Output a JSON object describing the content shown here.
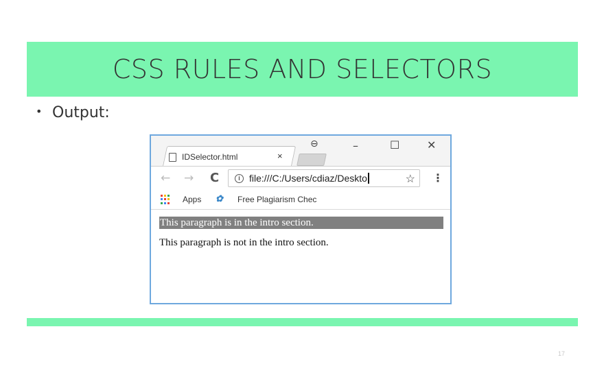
{
  "slide": {
    "title": "CSS RULES AND SELECTORS",
    "bullet_marker": "•",
    "bullet_text": "Output:",
    "page_number": "17",
    "accent_color": "#7af5b0"
  },
  "browser": {
    "tab_title": "IDSelector.html",
    "tab_close": "×",
    "window_controls": {
      "profile": "⊖",
      "minimize": "–",
      "maximize": "☐",
      "close": "✕"
    },
    "nav": {
      "back": "←",
      "forward": "→",
      "reload": "C"
    },
    "address": {
      "info_icon": "i",
      "url": "file:///C:/Users/cdiaz/Deskto"
    },
    "star": "☆",
    "menu": "⋮",
    "bookmarks": [
      {
        "icon": "apps-grid-icon",
        "label": "Apps"
      },
      {
        "icon": "favorite-icon",
        "label": "Free Plagiarism Chec"
      }
    ],
    "apps_grid_colors": [
      "#ea4335",
      "#fbbc05",
      "#34a853",
      "#4285f4",
      "#ea4335",
      "#fbbc05",
      "#34a853",
      "#4285f4",
      "#ea4335"
    ]
  },
  "content": {
    "paragraphs": [
      {
        "text": "This paragraph is in the intro section.",
        "highlight_color": "#808080"
      },
      {
        "text": "This paragraph is not in the intro section."
      }
    ]
  }
}
